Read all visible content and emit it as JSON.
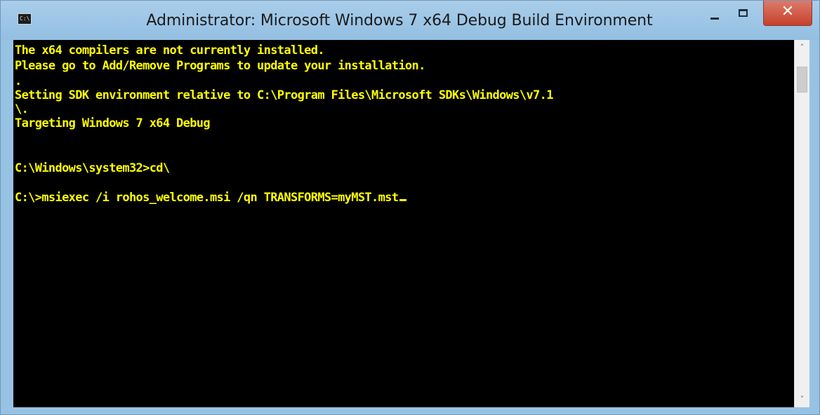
{
  "window": {
    "title": "Administrator:  Microsoft Windows 7 x64 Debug Build Environment",
    "app_icon": "cmd-icon",
    "app_icon_text": "C:\\",
    "frame_color": "#98c2e4",
    "close_color": "#c7402b"
  },
  "controls": {
    "minimize_icon": "minimize-icon",
    "maximize_icon": "maximize-icon",
    "close_icon": "close-icon",
    "close_glyph": "✕"
  },
  "console": {
    "text_color": "#ffff00",
    "background": "#000000",
    "lines": [
      "The x64 compilers are not currently installed.",
      "Please go to Add/Remove Programs to update your installation.",
      ".",
      "Setting SDK environment relative to C:\\Program Files\\Microsoft SDKs\\Windows\\v7.1",
      "\\.",
      "Targeting Windows 7 x64 Debug",
      "C:\\Windows\\system32>cd\\",
      "C:\\>msiexec /i rohos_welcome.msi /qn TRANSFORMS=myMST.mst"
    ]
  },
  "scrollbar": {
    "up_glyph": "˄",
    "down_glyph": "˅"
  }
}
